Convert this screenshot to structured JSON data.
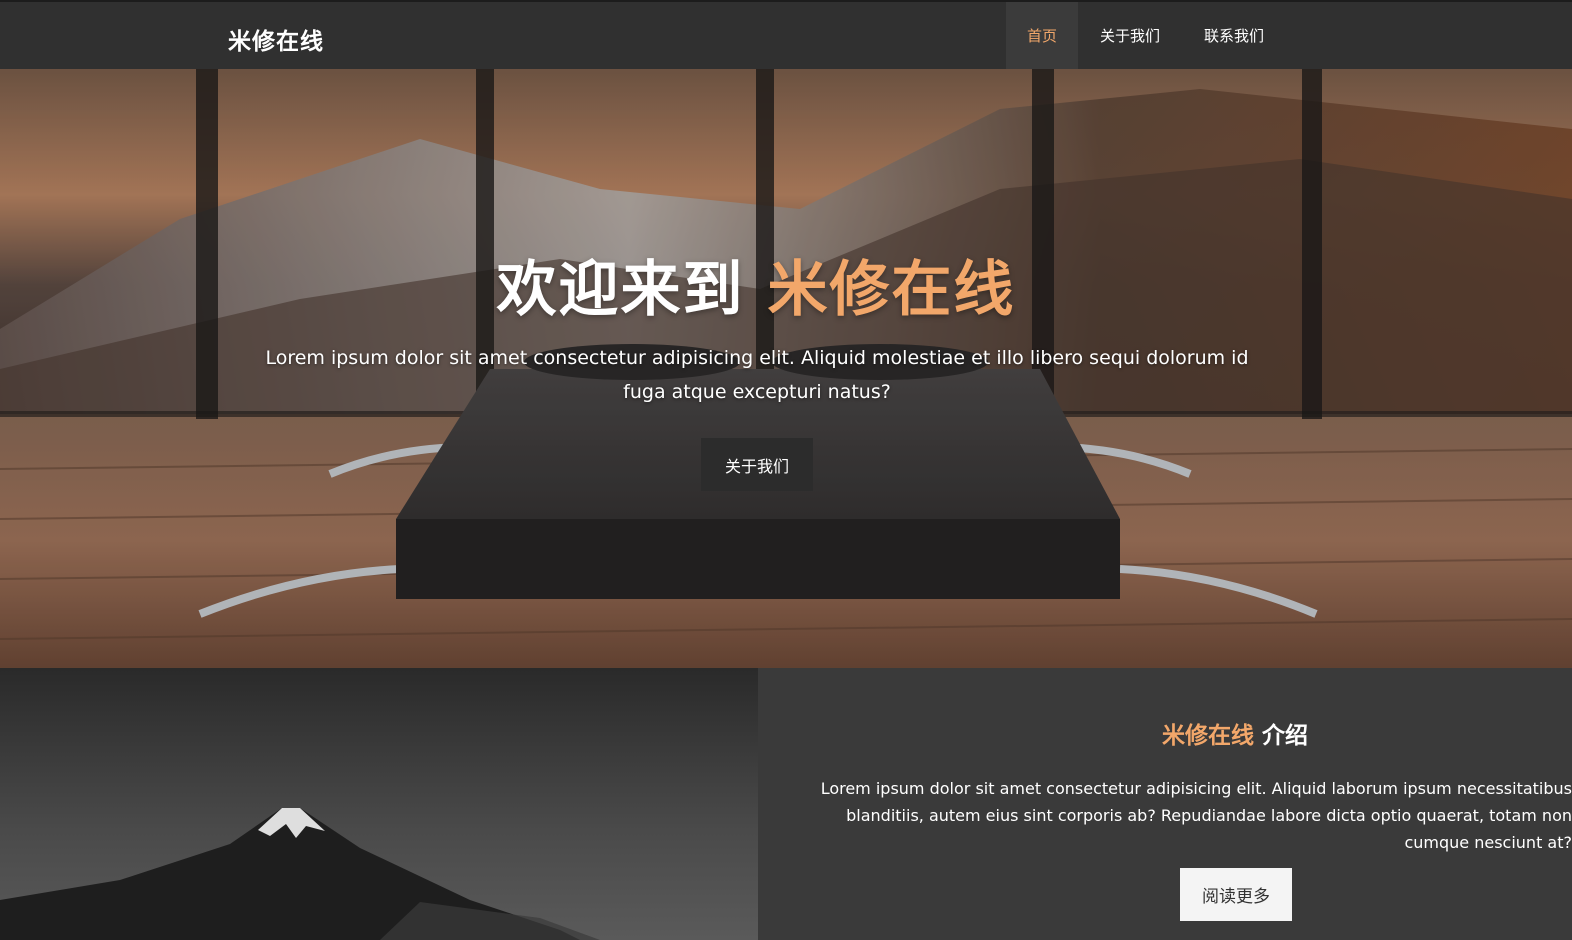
{
  "navbar": {
    "brand": "米修在线",
    "items": [
      {
        "label": "首页",
        "active": true
      },
      {
        "label": "关于我们",
        "active": false
      },
      {
        "label": "联系我们",
        "active": false
      }
    ]
  },
  "hero": {
    "title_prefix": "欢迎来到",
    "title_accent": "米修在线",
    "text": "Lorem ipsum dolor sit amet consectetur adipisicing elit. Aliquid molestiae et illo libero sequi dolorum id fuga atque excepturi natus?",
    "button_label": "关于我们"
  },
  "about": {
    "title_accent": "米修在线",
    "title_suffix": "介绍",
    "text": "Lorem ipsum dolor sit amet consectetur adipisicing elit. Aliquid laborum ipsum necessitatibus blanditiis, autem eius sint corporis ab? Repudiandae labore dicta optio quaerat, totam non cumque nesciunt at?",
    "button_label": "阅读更多"
  },
  "colors": {
    "accent": "#f2a76a",
    "navbar_bg": "#303030",
    "about_bg": "#3a3a3a"
  }
}
